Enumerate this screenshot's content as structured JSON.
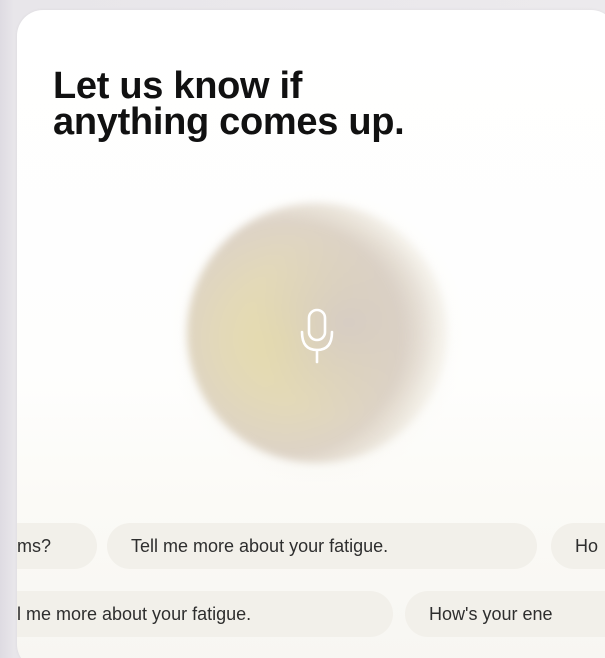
{
  "prompt": {
    "headline_line1": "Let us know if",
    "headline_line2": "anything comes up."
  },
  "voice": {
    "mic_icon": "microphone-icon",
    "orb_colors": [
      "#e6dcaa",
      "#d8cec4",
      "#ddd3c6"
    ]
  },
  "suggestions": {
    "row1": [
      "ms?",
      "Tell me more about your fatigue.",
      "Ho"
    ],
    "row2": [
      "l me more about your fatigue.",
      "How's your ene"
    ]
  },
  "colors": {
    "card_background": "#ffffff",
    "chip_background": "#f2f0ea",
    "headline_text": "#111111",
    "chip_text": "#2e2e2e"
  }
}
